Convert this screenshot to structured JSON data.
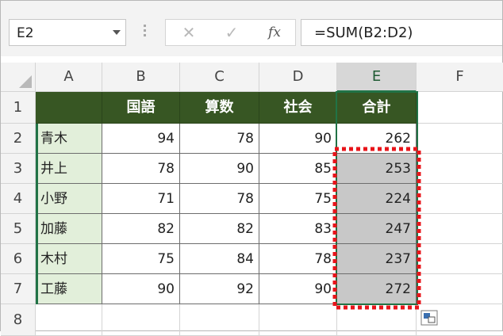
{
  "name_box": {
    "value": "E2"
  },
  "formula_bar": {
    "cancel_icon": "✕",
    "enter_icon": "✓",
    "fx_label": "fx",
    "formula": "=SUM(B2:D2)"
  },
  "columns": [
    "A",
    "B",
    "C",
    "D",
    "E",
    "F"
  ],
  "rows": [
    "1",
    "2",
    "3",
    "4",
    "5",
    "6",
    "7",
    "8"
  ],
  "selected_column": "E",
  "header_row": {
    "A": "",
    "B": "国語",
    "C": "算数",
    "D": "社会",
    "E": "合計"
  },
  "data_rows": [
    {
      "name": "青木",
      "b": "94",
      "c": "78",
      "d": "90",
      "e": "262"
    },
    {
      "name": "井上",
      "b": "78",
      "c": "90",
      "d": "85",
      "e": "253"
    },
    {
      "name": "小野",
      "b": "71",
      "c": "78",
      "d": "75",
      "e": "224"
    },
    {
      "name": "加藤",
      "b": "82",
      "c": "82",
      "d": "83",
      "e": "247"
    },
    {
      "name": "木村",
      "b": "75",
      "c": "84",
      "d": "78",
      "e": "237"
    },
    {
      "name": "工藤",
      "b": "90",
      "c": "92",
      "d": "90",
      "e": "272"
    }
  ],
  "colors": {
    "header_fill": "#375623",
    "name_fill": "#e2efda",
    "selection_green": "#217346",
    "highlight_red": "#e8141a",
    "autofill_fill": "#c8c8c8"
  },
  "icons": {
    "autofill_options": "paste-options-icon"
  }
}
